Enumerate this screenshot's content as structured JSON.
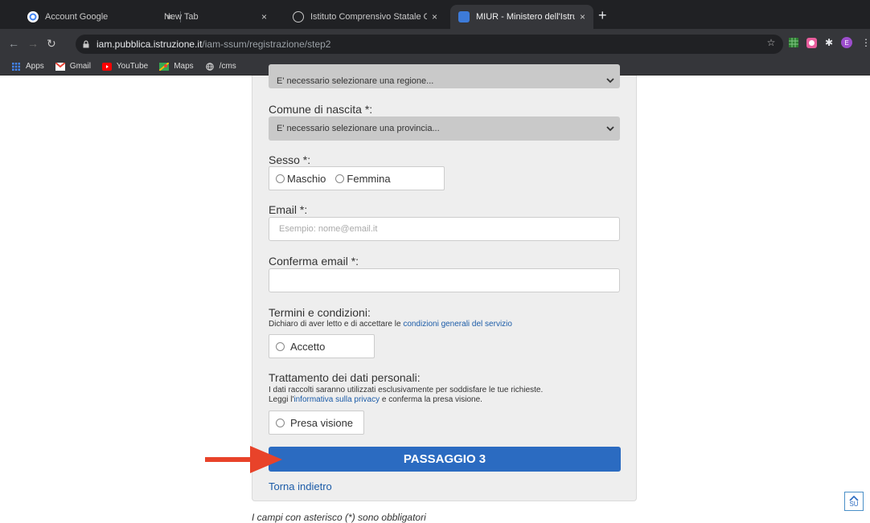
{
  "browser": {
    "tabs": [
      {
        "title": "Account Google",
        "close": "×"
      },
      {
        "title": "New Tab",
        "close": "×"
      },
      {
        "title": "Istituto Comprensivo Statale G",
        "close": "×"
      },
      {
        "title": "MIUR - Ministero dell'Istruzion",
        "close": "×"
      }
    ],
    "new_tab": "+",
    "url_host": "iam.pubblica.istruzione.it",
    "url_path": "/iam-ssum/registrazione/step2",
    "profile_initial": "E",
    "bookmarks": [
      "Apps",
      "Gmail",
      "YouTube",
      "Maps",
      "/cms"
    ]
  },
  "form": {
    "region_select": "E' necessario selezionare una regione...",
    "comune_label": "Comune di nascita *:",
    "comune_select": "E' necessario selezionare una provincia...",
    "sesso_label": "Sesso *:",
    "sesso_options": [
      "Maschio",
      "Femmina"
    ],
    "email_label": "Email *:",
    "email_placeholder": "Esempio: nome@email.it",
    "confirm_email_label": "Conferma email *:",
    "terms_title": "Termini e condizioni:",
    "terms_text_prefix": "Dichiaro di aver letto e di accettare le ",
    "terms_link": "condizioni generali del servizio",
    "accept_option": "Accetto",
    "privacy_title": "Trattamento dei dati personali:",
    "privacy_line1": "I dati raccolti saranno utilizzati esclusivamente per soddisfare le tue richieste.",
    "privacy_line2_prefix": "Leggi l'",
    "privacy_link": "informativa sulla privacy",
    "privacy_line2_suffix": " e conferma la presa visione.",
    "privacy_option": "Presa visione",
    "submit": "PASSAGGIO 3",
    "back": "Torna indietro",
    "footnote": "I campi con asterisco (*) sono obbligatori"
  },
  "scroll_top": "SU",
  "colors": {
    "primary": "#2b6bc1",
    "link": "#1c5ca8",
    "arrow": "#e8432a"
  }
}
